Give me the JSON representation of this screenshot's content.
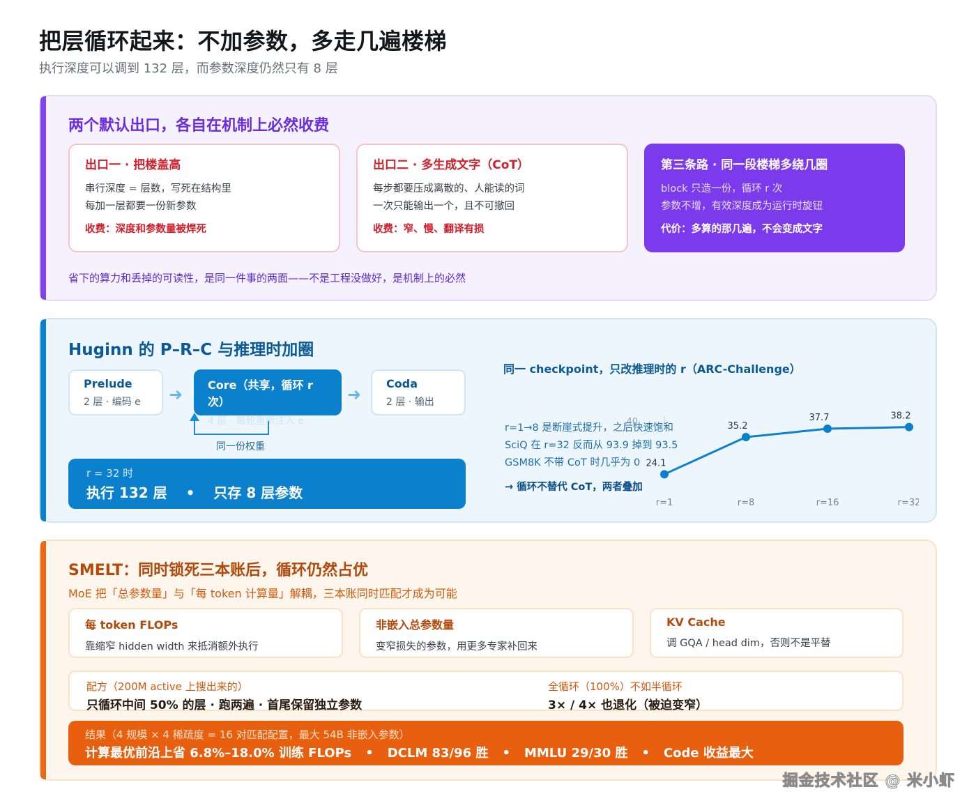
{
  "header": {
    "title": "把层循环起来：不加参数，多走几遍楼梯",
    "subtitle": "执行深度可以调到 132 层，而参数深度仍然只有 8 层"
  },
  "exits": {
    "title": "两个默认出口，各自在机制上必然收费",
    "cards": [
      {
        "heading": "出口一 · 把楼盖高",
        "line1": "串行深度 = 层数，写死在结构里",
        "line2": "每加一层都要一份新参数",
        "cost": "收费：深度和参数量被焊死"
      },
      {
        "heading": "出口二 · 多生成文字（CoT）",
        "line1": "每步都要压成离散的、人能读的词",
        "line2": "一次只能输出一个，且不可撤回",
        "cost": "收费：窄、慢、翻译有损"
      },
      {
        "heading": "第三条路 · 同一段楼梯多绕几圈",
        "line1": "block 只造一份，循环 r 次",
        "line2": "参数不增，有效深度成为运行时旋钮",
        "cost": "代价：多算的那几遍，不会变成文字"
      }
    ],
    "footer": "省下的算力和丢掉的可读性，是同一件事的两面——不是工程没做好，是机制上的必然"
  },
  "huginn": {
    "title": "Huginn 的 P–R–C 与推理时加圈",
    "prelude": {
      "name": "Prelude",
      "desc": "2 层 · 编码 e"
    },
    "core": {
      "name": "Core（共享，循环 r 次）",
      "desc": "4 层 · 每轮重新注入 e"
    },
    "coda": {
      "name": "Coda",
      "desc": "2 层 · 输出"
    },
    "loop_label": "同一份权重",
    "exec": {
      "small": "r = 32 时",
      "left": "执行 132 层",
      "dot": "•",
      "right": "只存 8 层参数"
    },
    "chart_title": "同一 checkpoint，只改推理时的 r（ARC-Challenge）",
    "notes": [
      "r=1→8 是断崖式提升，之后快速饱和",
      "SciQ 在 r=32 反而从 93.9 掉到 93.5",
      "GSM8K 不带 CoT 时几乎为 0"
    ],
    "conclusion": "→ 循环不替代 CoT，两者叠加",
    "accent": "#0b80cc"
  },
  "chart_data": {
    "type": "line",
    "categories": [
      "r=1",
      "r=8",
      "r=16",
      "r=32"
    ],
    "values": [
      24.1,
      35.2,
      37.7,
      38.2
    ],
    "ylim": [
      20,
      40
    ],
    "y_ticks": [
      20,
      40
    ],
    "title": "同一 checkpoint，只改推理时的 r（ARC-Challenge）",
    "xlabel": "",
    "ylabel": "",
    "grid": false
  },
  "smelt": {
    "title": "SMELT：同时锁死三本账后，循环仍然占优",
    "subtitle": "MoE 把「总参数量」与「每 token 计算量」解耦，三本账同时匹配才成为可能",
    "accounts": [
      {
        "heading": "每 token FLOPs",
        "desc": "靠缩窄 hidden width 来抵消额外执行"
      },
      {
        "heading": "非嵌入总参数量",
        "desc": "变窄损失的参数，用更多专家补回来"
      },
      {
        "heading": "KV Cache",
        "desc": "调 GQA / head dim，否则不是平替"
      }
    ],
    "recipe": {
      "label_left": "配方（200M active 上搜出来的）",
      "value_left": "只循环中间 50% 的层 · 跑两遍 · 首尾保留独立参数",
      "label_right": "全循环（100%）不如半循环",
      "value_right": "3× / 4× 也退化（被迫变窄）"
    },
    "result": {
      "small": "结果（4 规模 × 4 稀疏度 = 16 对匹配配置，最大 54B 非嵌入参数）",
      "items": [
        "计算最优前沿上省 6.8%–18.0% 训练 FLOPs",
        "DCLM 83/96 胜",
        "MMLU 29/30 胜",
        "Code 收益最大"
      ],
      "dot": "•"
    }
  },
  "watermark": "掘金技术社区 @ 米小虾"
}
